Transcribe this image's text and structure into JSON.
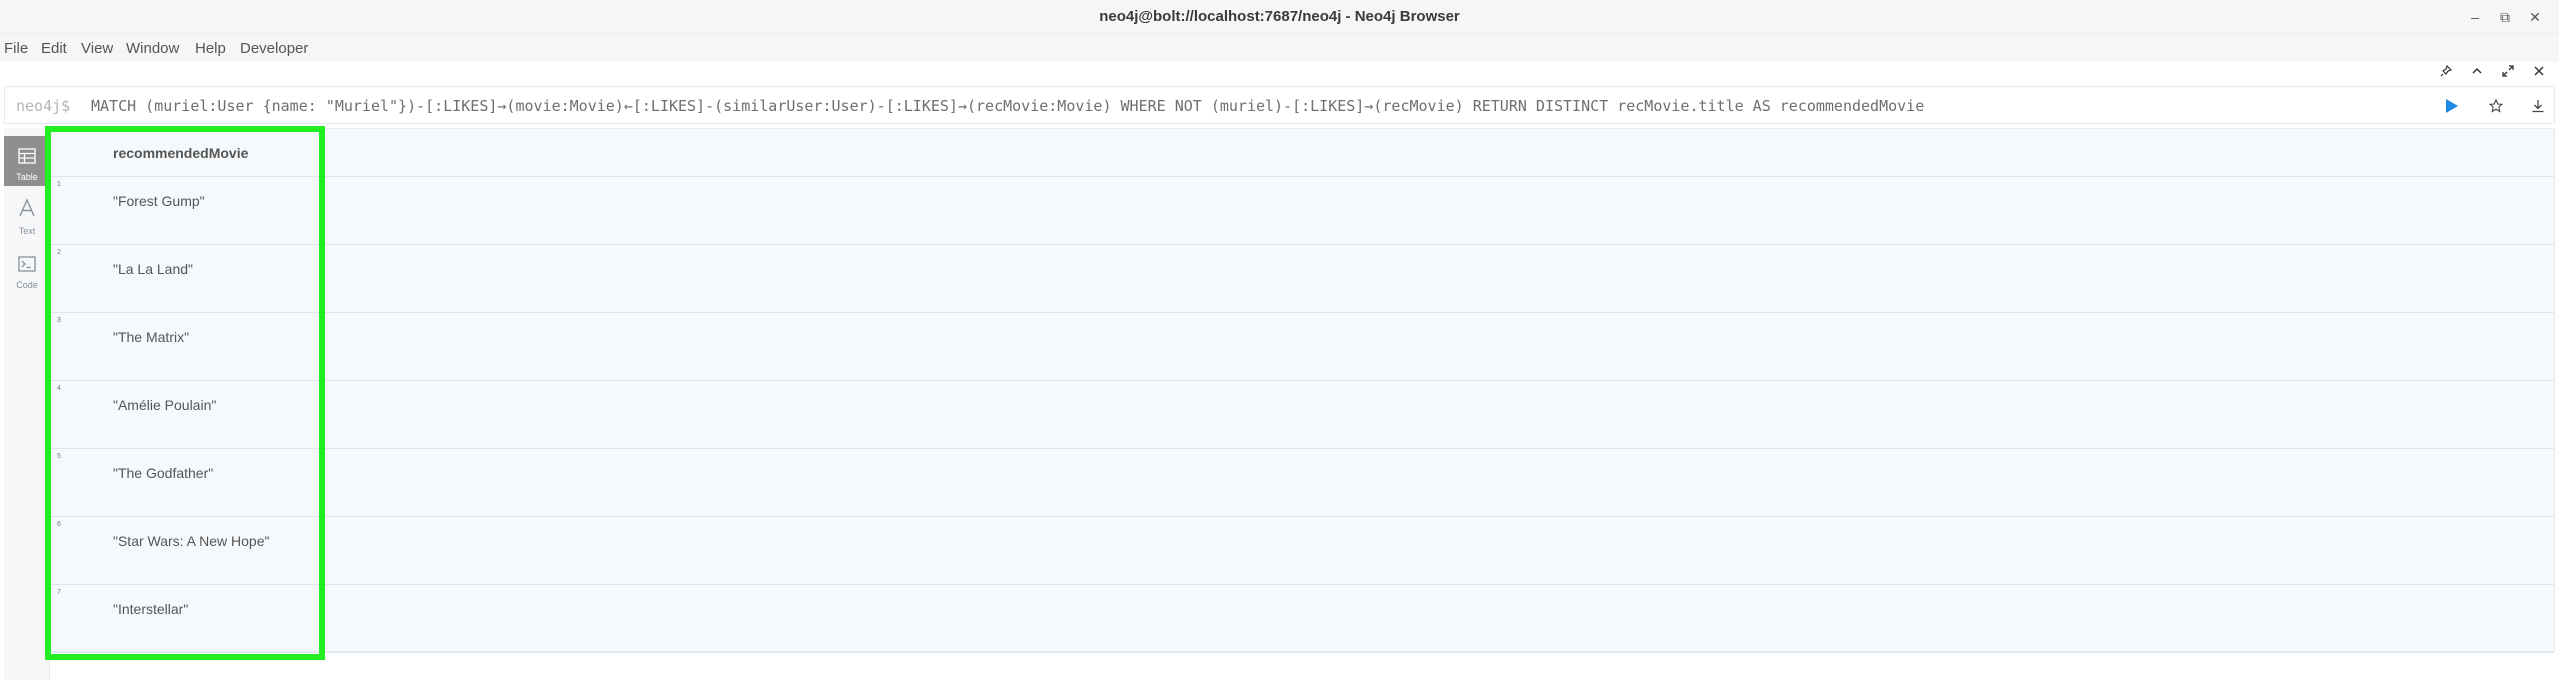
{
  "window": {
    "title": "neo4j@bolt://localhost:7687/neo4j - Neo4j Browser",
    "controls": [
      "–",
      "⧉",
      "✕"
    ]
  },
  "menu": [
    "File",
    "Edit",
    "View",
    "Window",
    "Help",
    "Developer"
  ],
  "editor": {
    "prompt": "neo4j$",
    "query": "MATCH (muriel:User {name: \"Muriel\"})-[:LIKES]→(movie:Movie)←[:LIKES]-(similarUser:User)-[:LIKES]→(recMovie:Movie) WHERE NOT (muriel)-[:LIKES]→(recMovie) RETURN DISTINCT recMovie.title AS recommendedMovie"
  },
  "views": [
    {
      "label": "Table",
      "icon": "table-icon",
      "active": true
    },
    {
      "label": "Text",
      "icon": "text-icon",
      "active": false
    },
    {
      "label": "Code",
      "icon": "code-icon",
      "active": false
    }
  ],
  "table": {
    "header": "recommendedMovie",
    "rows": [
      {
        "index": "1",
        "value": "\"Forest Gump\""
      },
      {
        "index": "2",
        "value": "\"La La Land\""
      },
      {
        "index": "3",
        "value": "\"The Matrix\""
      },
      {
        "index": "4",
        "value": "\"Amélie Poulain\""
      },
      {
        "index": "5",
        "value": "\"The Godfather\""
      },
      {
        "index": "6",
        "value": "\"Star Wars: A New Hope\""
      },
      {
        "index": "7",
        "value": "\"Interstellar\""
      }
    ]
  },
  "colors": {
    "highlight": "#22ee22",
    "run_button": "#1e88e5",
    "active_view": "#8f8f8f"
  }
}
